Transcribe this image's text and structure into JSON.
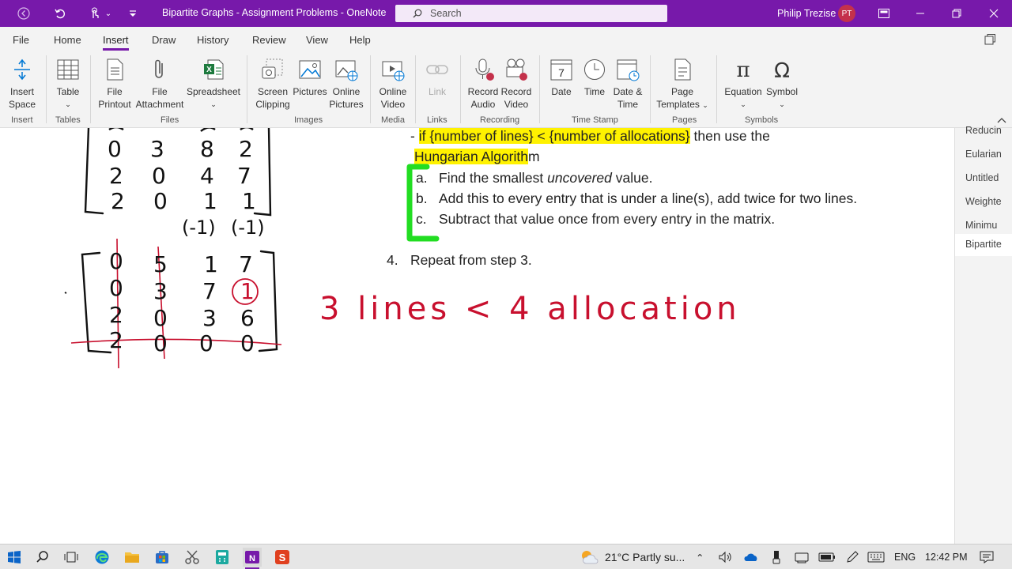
{
  "titlebar": {
    "title": "Bipartite Graphs - Assignment Problems  -  OneNote",
    "search_placeholder": "Search",
    "user_name": "Philip Trezise",
    "user_initials": "PT"
  },
  "menu": {
    "file": "File",
    "home": "Home",
    "insert": "Insert",
    "draw": "Draw",
    "history": "History",
    "review": "Review",
    "view": "View",
    "help": "Help"
  },
  "ribbon": {
    "insert_space": [
      "Insert",
      "Space"
    ],
    "table": "Table",
    "file_printout": [
      "File",
      "Printout"
    ],
    "file_attachment": [
      "File",
      "Attachment"
    ],
    "spreadsheet": "Spreadsheet",
    "screen_clipping": [
      "Screen",
      "Clipping"
    ],
    "pictures": "Pictures",
    "online_pictures": [
      "Online",
      "Pictures"
    ],
    "online_video": [
      "Online",
      "Video"
    ],
    "link": "Link",
    "record_audio": [
      "Record",
      "Audio"
    ],
    "record_video": [
      "Record",
      "Video"
    ],
    "date": "Date",
    "time": "Time",
    "date_time": [
      "Date &",
      "Time"
    ],
    "page_templates": [
      "Page",
      "Templates"
    ],
    "equation": "Equation",
    "symbol": "Symbol",
    "groups": {
      "insert": "Insert",
      "tables": "Tables",
      "files": "Files",
      "images": "Images",
      "media": "Media",
      "links": "Links",
      "recording": "Recording",
      "time_stamp": "Time Stamp",
      "pages": "Pages",
      "symbols": "Symbols"
    }
  },
  "note": {
    "line1_prefix": "- ",
    "line1_highlight": "if {number of lines} < {number of allocations}",
    "line1_suffix": " then use the",
    "line2_highlight": "Hungarian Algorith",
    "line2_suffix": "m",
    "step_a_marker": "a.",
    "step_a_pre": "Find the smallest ",
    "step_a_em": "uncovered",
    "step_a_post": " value.",
    "step_b_marker": "b.",
    "step_b": "Add this to every entry that is under a line(s), add twice for two lines.",
    "step_c_marker": "c.",
    "step_c": "Subtract that value once from every entry in the matrix.",
    "step4_marker": "4.",
    "step4": "Repeat from step 3."
  },
  "handwriting": {
    "matrix_top_rows": [
      [
        "0",
        "3",
        "8",
        "2"
      ],
      [
        "2",
        "0",
        "4",
        "7"
      ],
      [
        "2",
        "0",
        "1",
        "1"
      ]
    ],
    "column_adjust": [
      "(-1)",
      "(-1)"
    ],
    "matrix_bottom_rows": [
      [
        "0",
        "5",
        "1",
        "7"
      ],
      [
        "0",
        "3",
        "7",
        "1"
      ],
      [
        "2",
        "0",
        "3",
        "6"
      ],
      [
        "2",
        "0",
        "0",
        "0"
      ]
    ],
    "note": "3 lines < 4 allocation"
  },
  "pages": [
    "Reducin",
    "Eularian",
    "Untitled",
    "Weighte",
    "Minimu",
    "Bipartite"
  ],
  "active_page_index": 5,
  "taskbar": {
    "weather": "21°C  Partly su...",
    "language": "ENG",
    "clock": "12:42 PM"
  },
  "colors": {
    "onenote_purple": "#7719aa",
    "highlight_yellow": "#fff200",
    "ink_black": "#111111",
    "ink_red": "#c8102e",
    "marker_green": "#22dd22"
  }
}
